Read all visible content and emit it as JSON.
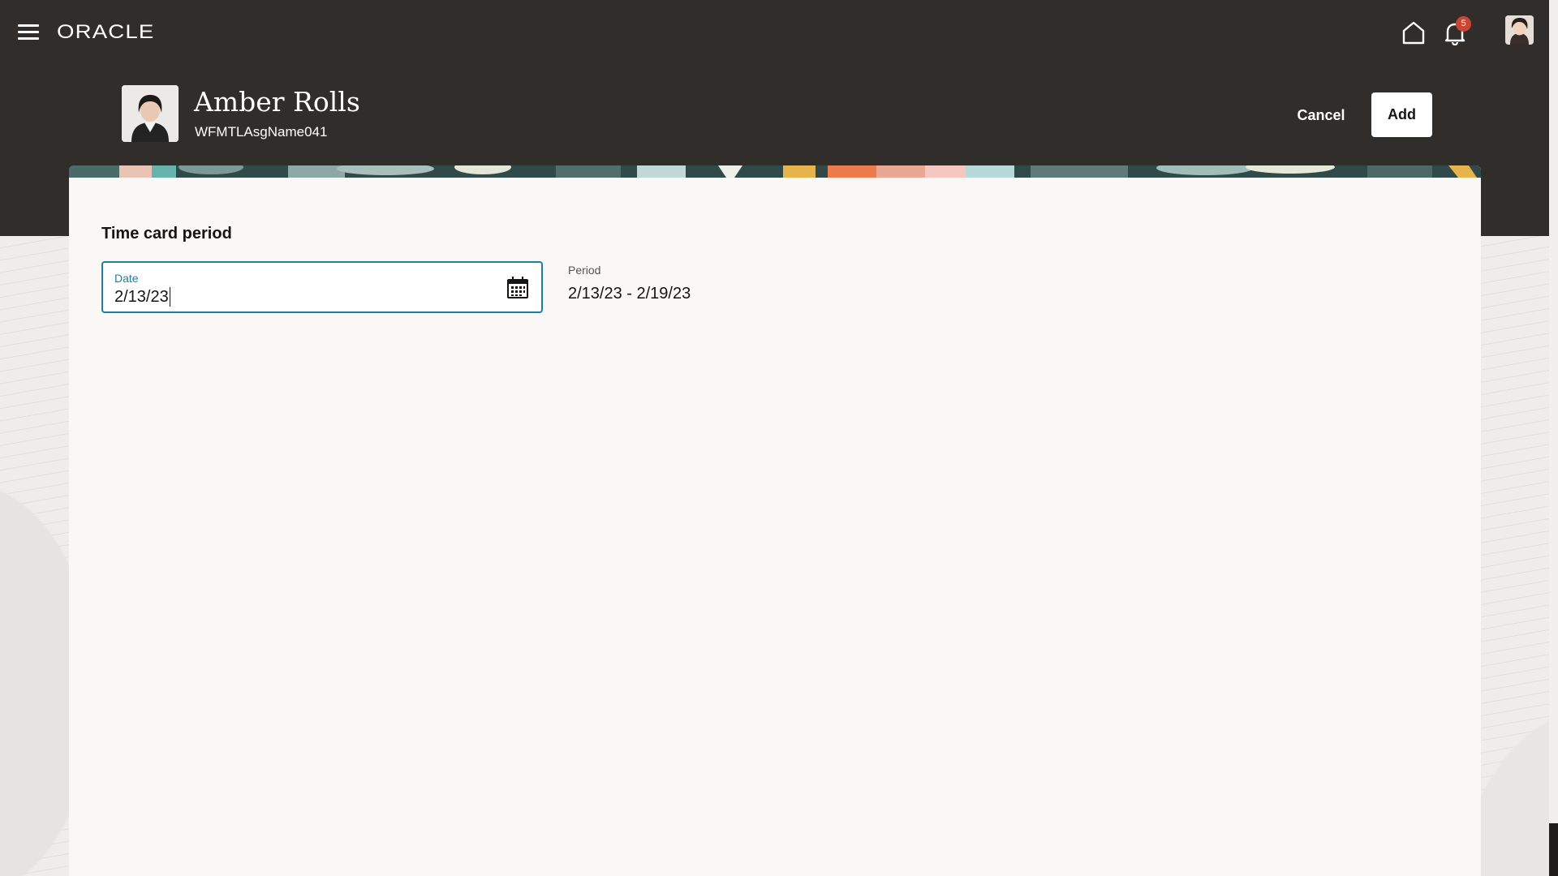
{
  "topbar": {
    "brand": "ORACLE",
    "notifications_count": "5",
    "icons": {
      "menu": "hamburger-menu-icon",
      "home": "home-icon",
      "notifications": "bell-icon",
      "user": "user-avatar"
    }
  },
  "person": {
    "name": "Amber Rolls",
    "assignment": "WFMTLAsgName041"
  },
  "actions": {
    "cancel_label": "Cancel",
    "add_label": "Add"
  },
  "form": {
    "section_title": "Time card period",
    "date_label": "Date",
    "date_value": "2/13/23",
    "calendar_icon": "calendar-icon",
    "period_label": "Period",
    "period_value": "2/13/23 - 2/19/23"
  },
  "colors": {
    "header_bg": "#312d2a",
    "card_bg": "#f9f8f6",
    "focus_accent": "#227e9e",
    "badge": "#c74634"
  }
}
